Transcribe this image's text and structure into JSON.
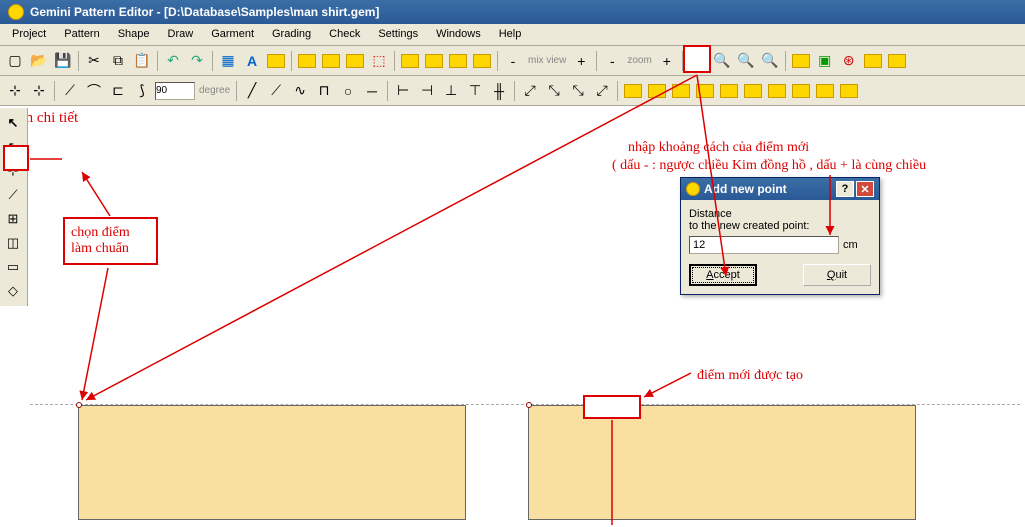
{
  "title": "Gemini Pattern Editor - [D:\\Database\\Samples\\man shirt.gem]",
  "menu": [
    "Project",
    "Pattern",
    "Shape",
    "Draw",
    "Garment",
    "Grading",
    "Check",
    "Settings",
    "Windows",
    "Help"
  ],
  "toolbar_degree": {
    "value": "90",
    "unit": "degree"
  },
  "toolbar_mix": {
    "minus": "-",
    "label": "mix view",
    "plus": "+"
  },
  "toolbar_zoom": {
    "minus": "-",
    "label": "zoom",
    "plus": "+"
  },
  "anno": {
    "chon_diem": "chọn điểm làm chuẩn",
    "chon_chi_tiet": "chọn chi tiết",
    "diem_moi": "điểm mới được tạo",
    "nhap1": "nhập khoảng cách của điểm mới",
    "nhap2": "( dấu - : ngược chiều Kim đồng hồ , dấu + là cùng chiều"
  },
  "dialog": {
    "title": "Add new point",
    "label1": "Distance",
    "label2": "to the new created point:",
    "value": "12",
    "unit": "cm",
    "accept": "Accept",
    "quit": "Quit"
  }
}
